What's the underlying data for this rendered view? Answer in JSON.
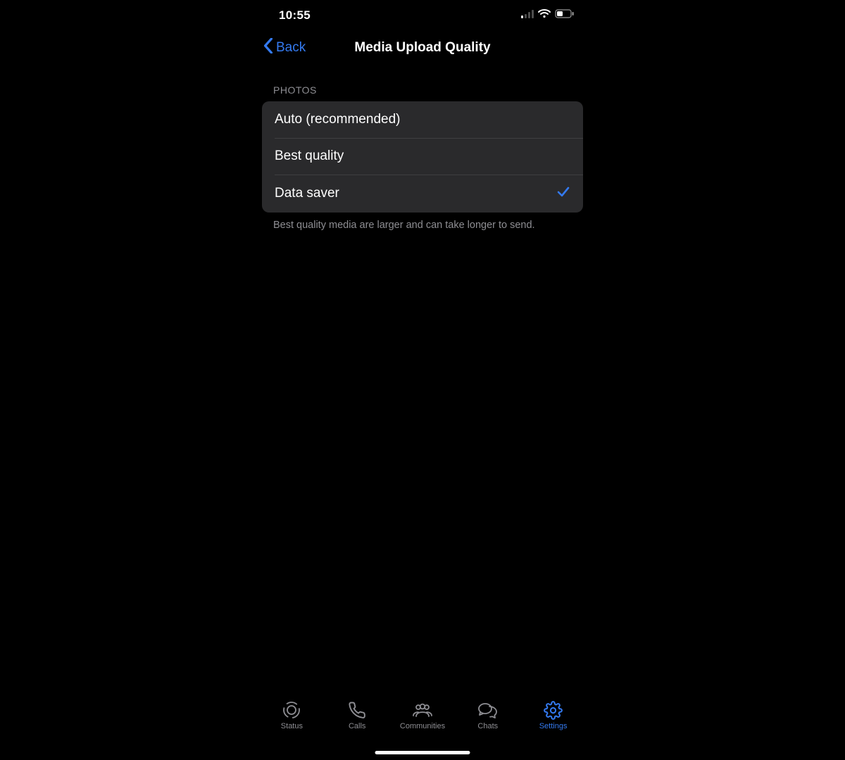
{
  "status": {
    "time": "10:55"
  },
  "nav": {
    "back_label": "Back",
    "title": "Media Upload Quality"
  },
  "section": {
    "header": "PHOTOS",
    "options": [
      {
        "label": "Auto (recommended)",
        "selected": false
      },
      {
        "label": "Best quality",
        "selected": false
      },
      {
        "label": "Data saver",
        "selected": true
      }
    ],
    "footer": "Best quality media are larger and can take longer to send."
  },
  "tabs": [
    {
      "name": "status",
      "label": "Status",
      "active": false,
      "icon": "status"
    },
    {
      "name": "calls",
      "label": "Calls",
      "active": false,
      "icon": "calls"
    },
    {
      "name": "communities",
      "label": "Communities",
      "active": false,
      "icon": "communities"
    },
    {
      "name": "chats",
      "label": "Chats",
      "active": false,
      "icon": "chats"
    },
    {
      "name": "settings",
      "label": "Settings",
      "active": true,
      "icon": "settings"
    }
  ]
}
